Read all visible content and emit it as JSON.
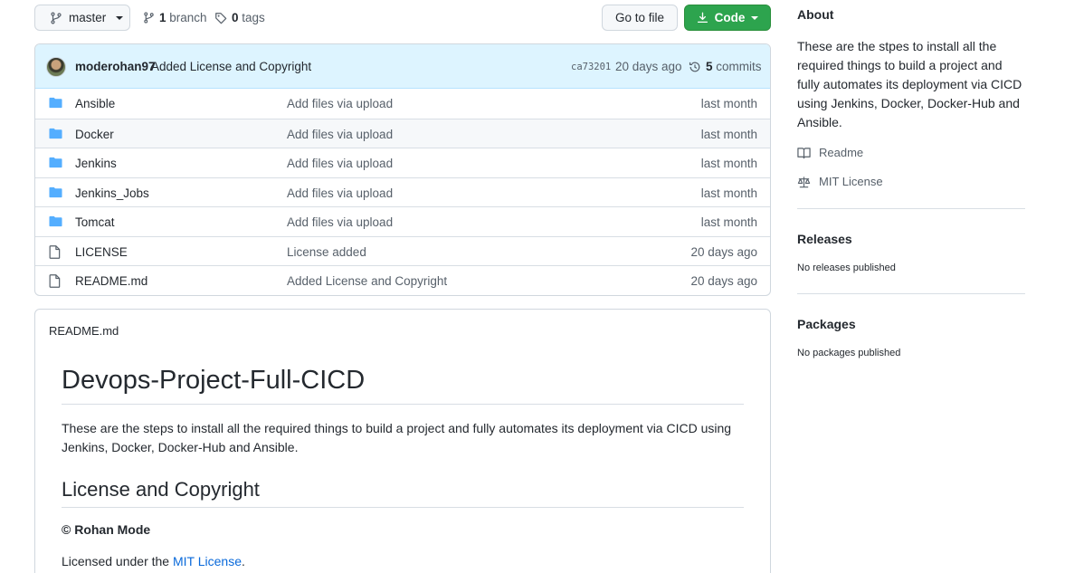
{
  "topbar": {
    "branch_name": "master",
    "branches_count": "1",
    "branches_label": "branch",
    "tags_count": "0",
    "tags_label": "tags",
    "goto_label": "Go to file",
    "code_label": "Code"
  },
  "commit": {
    "author": "moderohan97",
    "message": "Added License and Copyright",
    "hash": "ca73201",
    "time": "20 days ago",
    "count": "5",
    "count_label": "commits"
  },
  "files": [
    {
      "name": "Ansible",
      "type": "folder",
      "message": "Add files via upload",
      "age": "last month"
    },
    {
      "name": "Docker",
      "type": "folder",
      "message": "Add files via upload",
      "age": "last month"
    },
    {
      "name": "Jenkins",
      "type": "folder",
      "message": "Add files via upload",
      "age": "last month"
    },
    {
      "name": "Jenkins_Jobs",
      "type": "folder",
      "message": "Add files via upload",
      "age": "last month"
    },
    {
      "name": "Tomcat",
      "type": "folder",
      "message": "Add files via upload",
      "age": "last month"
    },
    {
      "name": "LICENSE",
      "type": "file",
      "message": "License added",
      "age": "20 days ago"
    },
    {
      "name": "README.md",
      "type": "file",
      "message": "Added License and Copyright",
      "age": "20 days ago"
    }
  ],
  "readme": {
    "filename": "README.md",
    "h1": "Devops-Project-Full-CICD",
    "paragraph": "These are the steps to install all the required things to build a project and fully automates its deployment via CICD using Jenkins, Docker, Docker-Hub and Ansible.",
    "h2": "License and Copyright",
    "copyright": "© Rohan Mode",
    "license_prefix": "Licensed under the ",
    "license_link": "MIT License",
    "license_suffix": "."
  },
  "sidebar": {
    "about_title": "About",
    "about_text": "These are the stpes to install all the required things to build a project and fully automates its deployment via CICD using Jenkins, Docker, Docker-Hub and Ansible.",
    "readme_link": "Readme",
    "license_link": "MIT License",
    "releases_title": "Releases",
    "releases_text": "No releases published",
    "packages_title": "Packages",
    "packages_text": "No packages published"
  },
  "colors": {
    "accent": "#0969da",
    "code_button": "#2da44e",
    "folder_icon": "#54aeff",
    "commit_bar": "#ddf4ff"
  }
}
